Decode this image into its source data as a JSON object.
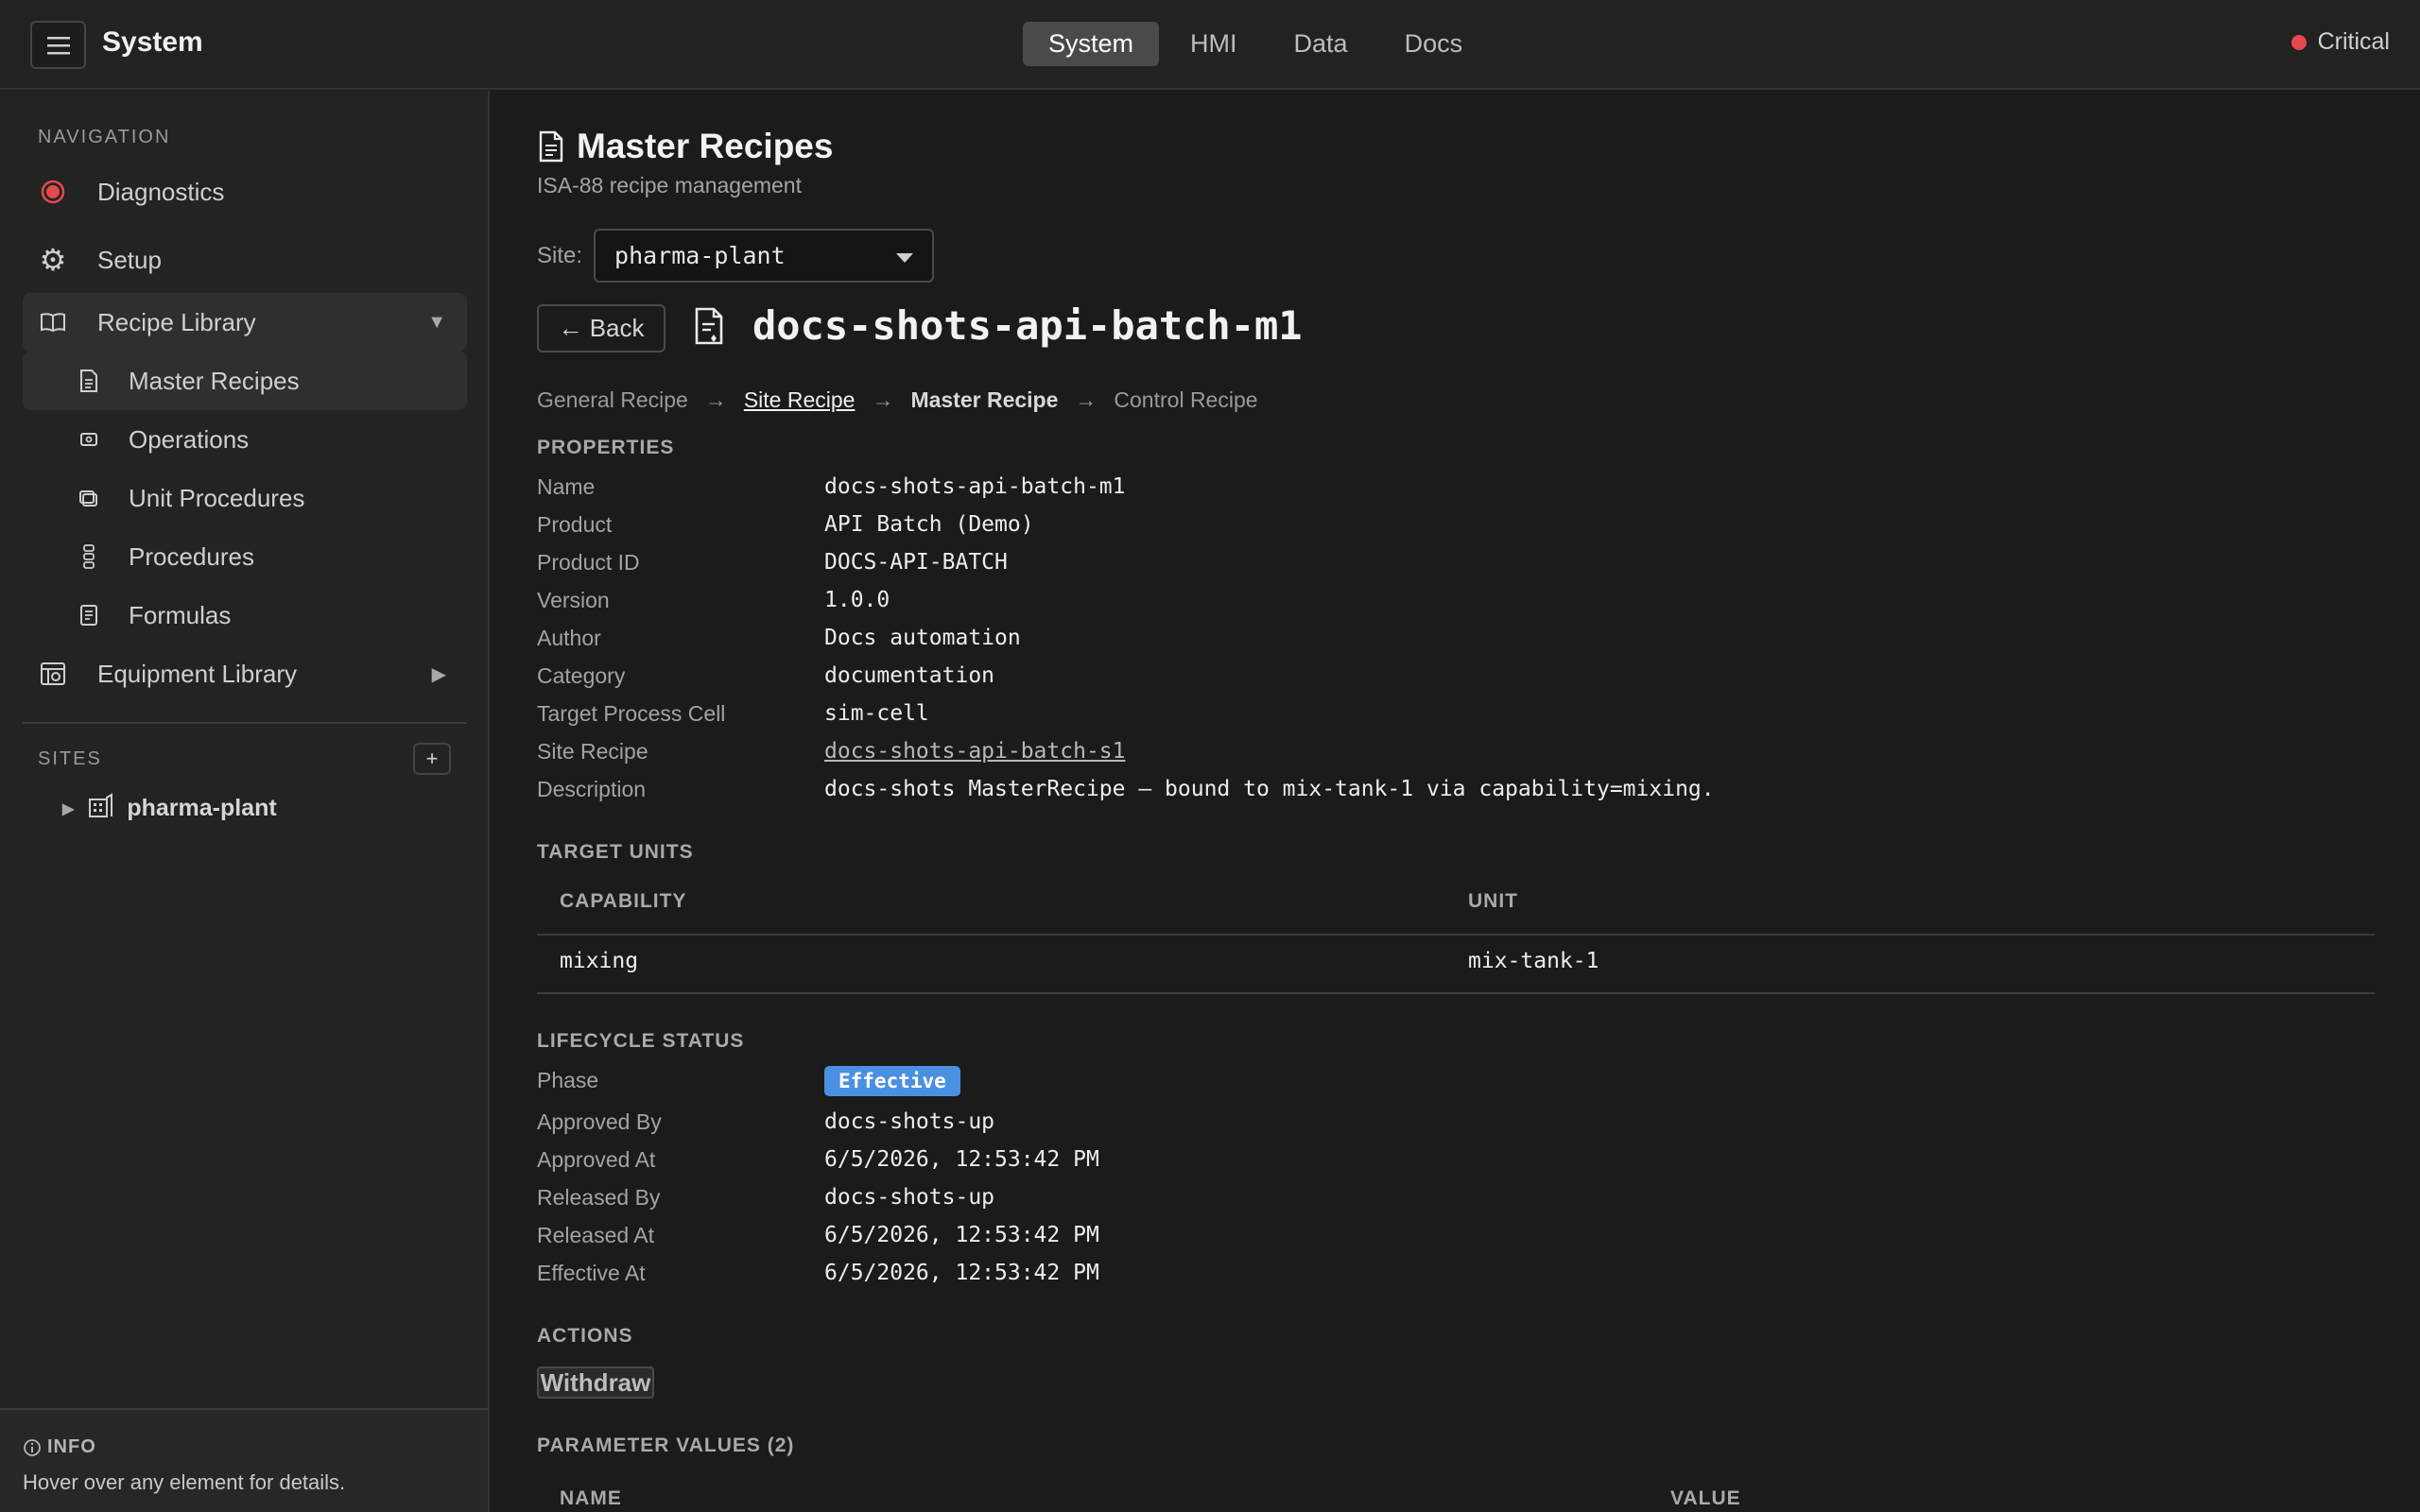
{
  "header": {
    "app_title": "System",
    "tabs": [
      {
        "label": "System",
        "active": true
      },
      {
        "label": "HMI"
      },
      {
        "label": "Data"
      },
      {
        "label": "Docs"
      }
    ],
    "status": {
      "label": "Critical",
      "color": "#e5484d"
    }
  },
  "sidebar": {
    "nav_heading": "NAVIGATION",
    "items": [
      {
        "label": "Diagnostics",
        "icon": "record-icon"
      },
      {
        "label": "Setup",
        "icon": "gear-icon"
      },
      {
        "label": "Recipe Library",
        "icon": "book-icon",
        "expanded": true
      },
      {
        "label": "Master Recipes",
        "icon": "document-icon",
        "selected": true
      },
      {
        "label": "Operations",
        "icon": "operation-icon"
      },
      {
        "label": "Unit Procedures",
        "icon": "layers-icon"
      },
      {
        "label": "Procedures",
        "icon": "steps-icon"
      },
      {
        "label": "Formulas",
        "icon": "formula-icon"
      },
      {
        "label": "Equipment Library",
        "icon": "equipment-icon"
      }
    ],
    "sites_heading": "SITES",
    "add_site_label": "+",
    "sites": [
      {
        "label": "pharma-plant"
      }
    ],
    "info": {
      "title": "INFO",
      "text": "Hover over any element for details."
    }
  },
  "main": {
    "title": "Master Recipes",
    "subtitle": "ISA-88 recipe management",
    "site_label": "Site:",
    "site_value": "pharma-plant",
    "back_label": "← Back",
    "recipe_name": "docs-shots-api-batch-m1",
    "breadcrumb": {
      "general": "General Recipe",
      "site": "Site Recipe",
      "master": "Master Recipe",
      "control": "Control Recipe",
      "arrow": "→"
    },
    "properties_heading": "PROPERTIES",
    "properties": [
      {
        "key": "Name",
        "value": "docs-shots-api-batch-m1"
      },
      {
        "key": "Product",
        "value": "API Batch (Demo)"
      },
      {
        "key": "Product ID",
        "value": "DOCS-API-BATCH"
      },
      {
        "key": "Version",
        "value": "1.0.0"
      },
      {
        "key": "Author",
        "value": "Docs automation"
      },
      {
        "key": "Category",
        "value": "documentation"
      },
      {
        "key": "Target Process Cell",
        "value": "sim-cell"
      },
      {
        "key": "Site Recipe",
        "value": "docs-shots-api-batch-s1"
      },
      {
        "key": "Description",
        "value": "docs-shots MasterRecipe — bound to mix-tank-1 via capability=mixing."
      }
    ],
    "target_units_heading": "TARGET UNITS",
    "target_units": {
      "columns": [
        "CAPABILITY",
        "UNIT"
      ],
      "rows": [
        [
          "mixing",
          "mix-tank-1"
        ]
      ]
    },
    "lifecycle_heading": "LIFECYCLE STATUS",
    "lifecycle": {
      "phase_label": "Phase",
      "phase_value": "Effective",
      "phase_color": "#4a90e2",
      "fields": [
        {
          "key": "Approved By",
          "value": "docs-shots-up"
        },
        {
          "key": "Approved At",
          "value": "6/5/2026, 12:53:42 PM"
        },
        {
          "key": "Released By",
          "value": "docs-shots-up"
        },
        {
          "key": "Released At",
          "value": "6/5/2026, 12:53:42 PM"
        },
        {
          "key": "Effective At",
          "value": "6/5/2026, 12:53:42 PM"
        }
      ]
    },
    "actions_heading": "ACTIONS",
    "withdraw_label": "Withdraw",
    "parameters_heading": "PARAMETER VALUES (2)",
    "parameters_columns": [
      "NAME",
      "VALUE"
    ]
  }
}
